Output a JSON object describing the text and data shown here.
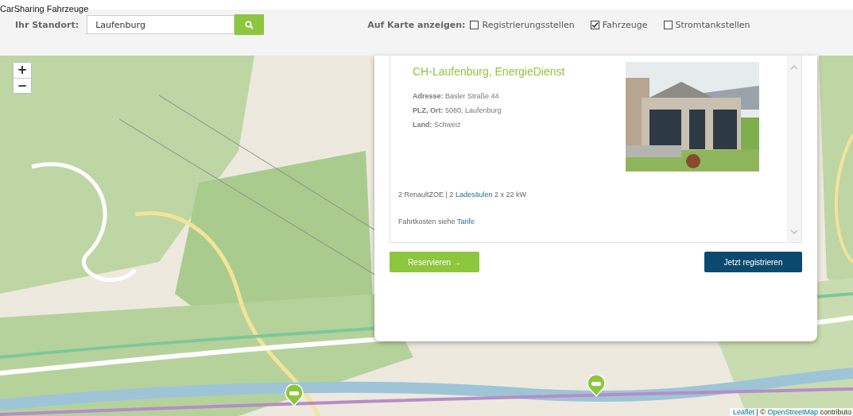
{
  "page_title": "CarSharing Fahrzeuge",
  "location": {
    "label": "Ihr Standort:",
    "value": "Laufenburg"
  },
  "map_filters": {
    "label": "Auf Karte anzeigen:",
    "options": [
      {
        "label": "Registrierungsstellen",
        "checked": false
      },
      {
        "label": "Fahrzeuge",
        "checked": true
      },
      {
        "label": "Stromtankstellen",
        "checked": false
      }
    ]
  },
  "map": {
    "kind": "picture",
    "zoom_in": "+",
    "zoom_out": "−",
    "attribution": {
      "link": "Leaflet",
      "separator": "| ©",
      "source": "OpenStreetMap",
      "suffix": "contributo"
    }
  },
  "station": {
    "title": "CH-Laufenburg, EnergieDienst",
    "fields": [
      {
        "label": "Adresse:",
        "value": "Basler Straße 44"
      },
      {
        "label": "PLZ, Ort:",
        "value": "5080, Laufenburg"
      },
      {
        "label": "Land:",
        "value": "Schweiz"
      }
    ],
    "vehicles": {
      "text": "2 RenaultZOE | 2",
      "link": "Ladesäulen",
      "suffix": "2 x 22 kW"
    },
    "costs": {
      "text": "Fahrtkosten siehe",
      "link": "Tarife"
    }
  },
  "actions": [
    {
      "label": "Reservieren →",
      "kind": "primary"
    },
    {
      "label": "Jetzt registrieren",
      "kind": "secondary"
    }
  ]
}
